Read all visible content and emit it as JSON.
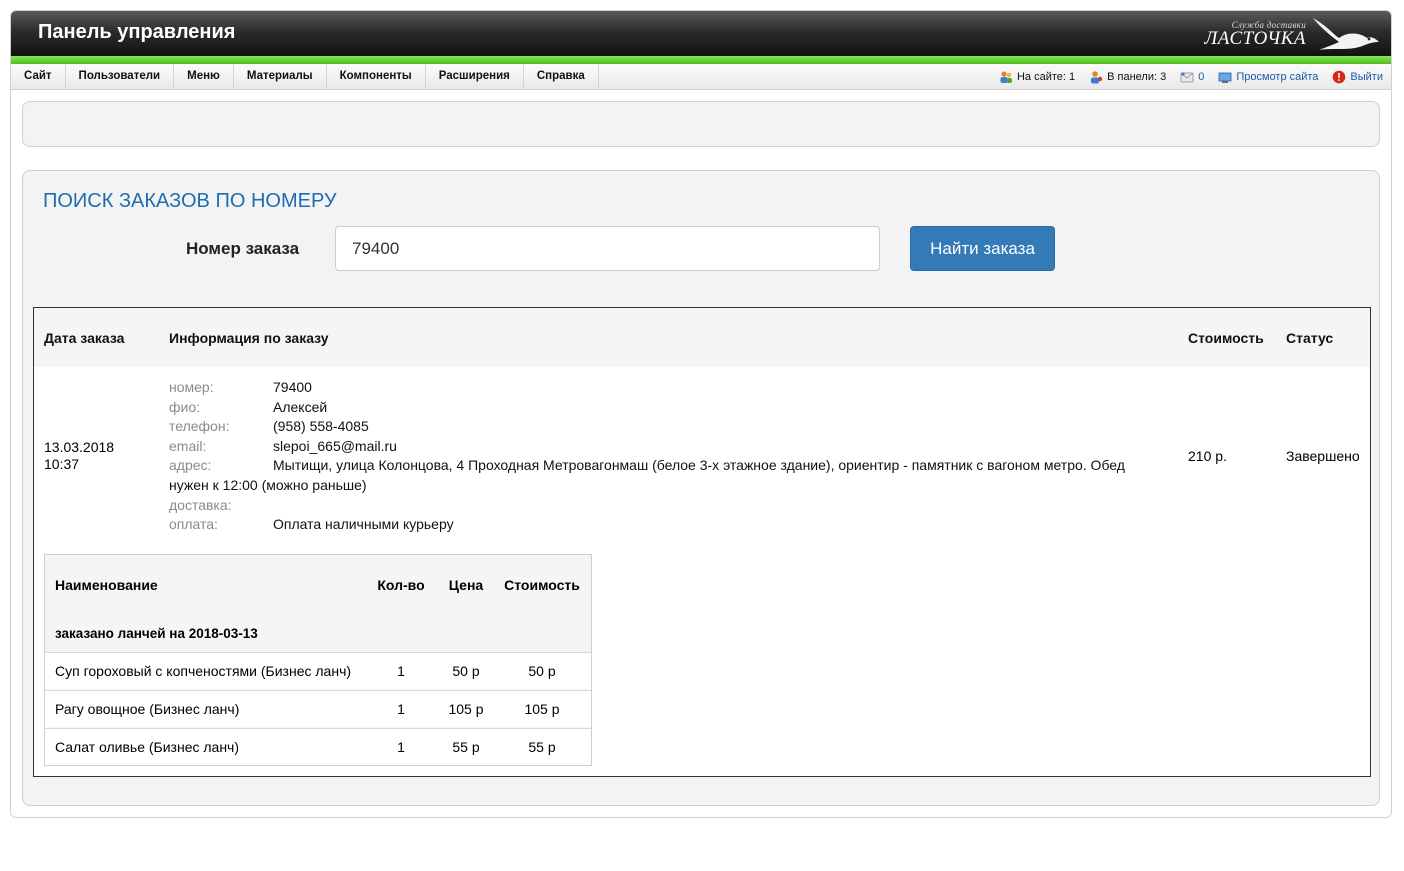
{
  "header": {
    "title": "Панель управления",
    "logo_small": "Служба доставки",
    "logo_big": "ЛАСТОЧКА"
  },
  "menu": [
    "Сайт",
    "Пользователи",
    "Меню",
    "Материалы",
    "Компоненты",
    "Расширения",
    "Справка"
  ],
  "status": {
    "on_site": "На сайте: 1",
    "in_panel": "В панели: 3",
    "messages": "0",
    "view_site": "Просмотр сайта",
    "logout": "Выйти"
  },
  "search": {
    "title": "ПОИСК ЗАКАЗОВ ПО НОМЕРУ",
    "label": "Номер заказа",
    "value": "79400",
    "button": "Найти заказа"
  },
  "orders_table": {
    "headers": {
      "date": "Дата заказа",
      "info": "Информация по заказу",
      "cost": "Стоимость",
      "status": "Статус"
    },
    "order": {
      "date": "13.03.2018",
      "time": "10:37",
      "info": [
        {
          "key": "номер:",
          "value": "79400"
        },
        {
          "key": "фио:",
          "value": "Алексей"
        },
        {
          "key": "телефон:",
          "value": "(958) 558-4085"
        },
        {
          "key": "email:",
          "value": "slepoi_665@mail.ru"
        },
        {
          "key": "адрес:",
          "value": "Мытищи, улица Колонцова, 4 Проходная Метровагонмаш (белое 3-х этажное здание), ориентир - памятник с вагоном метро. Обед нужен к 12:00 (можно раньше)"
        },
        {
          "key": "доставка:",
          "value": ""
        },
        {
          "key": "оплата:",
          "value": "Оплата наличными курьеру"
        }
      ],
      "cost": "210 р.",
      "status": "Завершено"
    }
  },
  "items_table": {
    "headers": {
      "name": "Наименование",
      "qty": "Кол-во",
      "price": "Цена",
      "cost": "Стоимость"
    },
    "group": "заказано ланчей на 2018-03-13",
    "rows": [
      {
        "name": "Суп гороховый с копченостями (Бизнес ланч)",
        "qty": "1",
        "price": "50 р",
        "cost": "50 р"
      },
      {
        "name": "Рагу овощное (Бизнес ланч)",
        "qty": "1",
        "price": "105 р",
        "cost": "105 р"
      },
      {
        "name": "Салат оливье (Бизнес ланч)",
        "qty": "1",
        "price": "55 р",
        "cost": "55 р"
      }
    ]
  },
  "colors": {
    "accent": "#337ab7",
    "title_blue": "#1f6cb0",
    "green_bar": "#5ccc2a",
    "logout_red": "#d8261a"
  }
}
